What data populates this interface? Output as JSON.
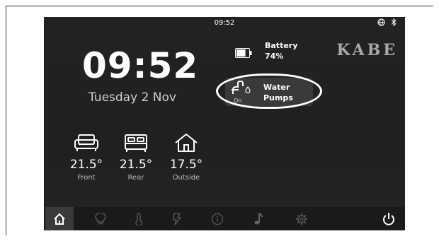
{
  "status": {
    "time": "09:52",
    "icons": [
      "globe-icon",
      "bluetooth-icon"
    ]
  },
  "clock": {
    "time": "09:52",
    "date": "Tuesday 2 Nov"
  },
  "battery": {
    "label": "Battery",
    "value": "74%",
    "level": 0.74
  },
  "brand": "KABE",
  "water_pumps": {
    "state": "On",
    "label_line1": "Water",
    "label_line2": "Pumps"
  },
  "temperatures": [
    {
      "icon": "sofa-icon",
      "value": "21.5°",
      "label": "Front"
    },
    {
      "icon": "bed-icon",
      "value": "21.5°",
      "label": "Rear"
    },
    {
      "icon": "house-icon",
      "value": "17.5°",
      "label": "Outside"
    }
  ],
  "nav": [
    "home-icon",
    "light-bulb-icon",
    "thermometer-icon",
    "power-bolt-icon",
    "info-icon",
    "music-icon",
    "settings-gear-icon",
    "power-icon"
  ],
  "colors": {
    "screen_bg": "#222222",
    "nav_bg": "#1a1a1a",
    "active_nav": "#3a3a3a",
    "text": "#ffffff",
    "muted": "#bdbdbd"
  }
}
